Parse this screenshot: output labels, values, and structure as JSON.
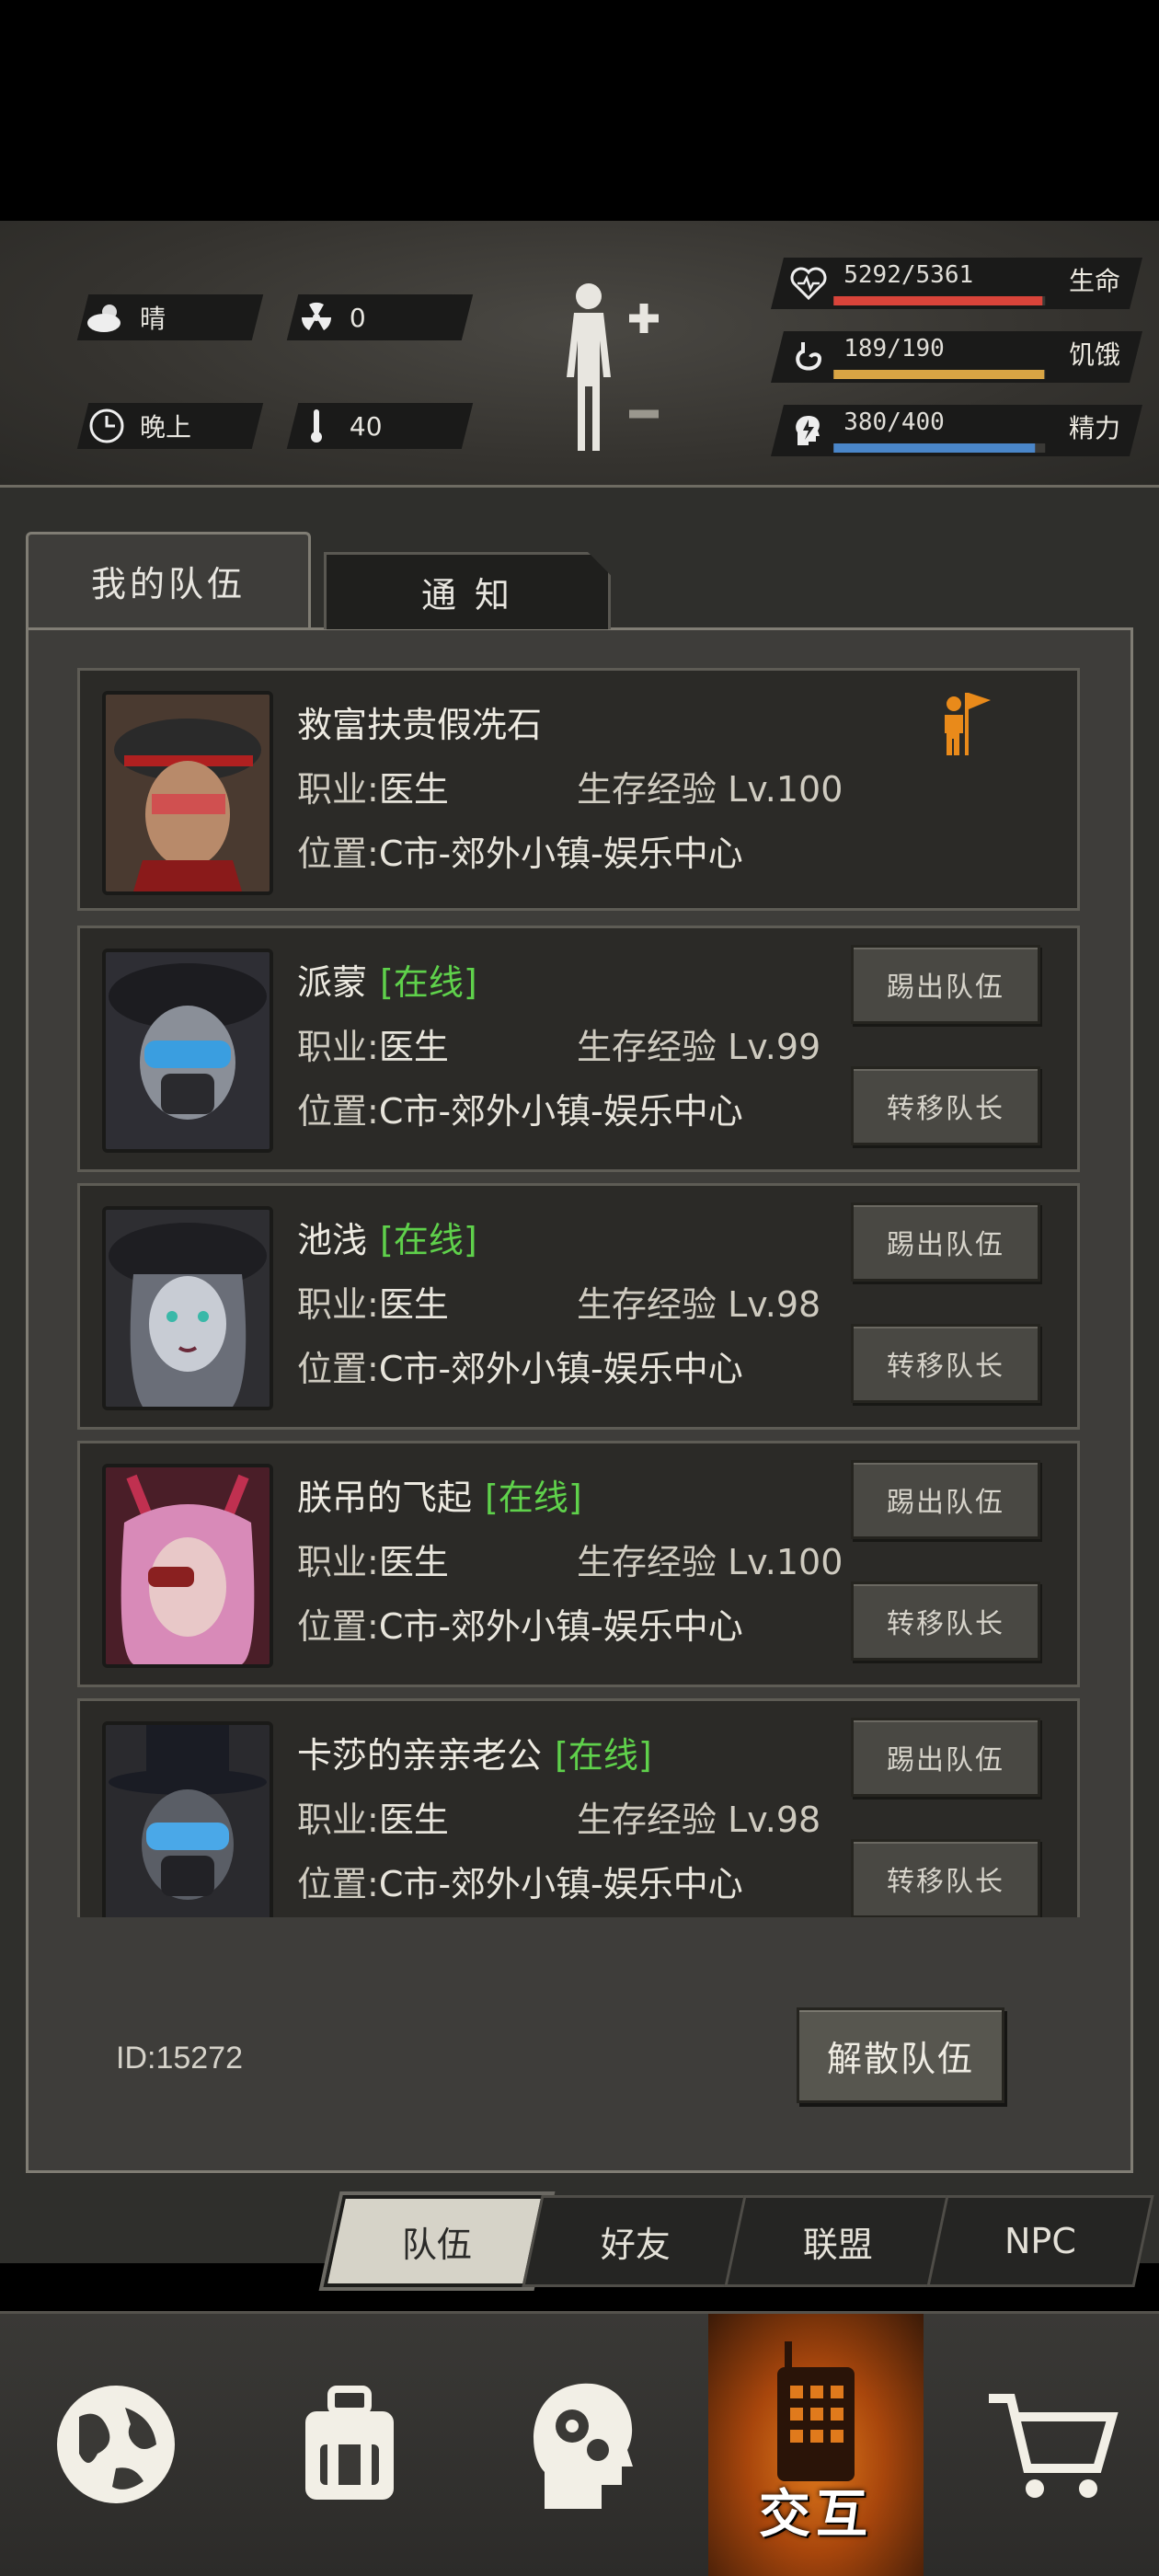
{
  "status": {
    "weather": "晴",
    "radiation": "0",
    "time_of_day": "晚上",
    "temperature": "40",
    "stats": [
      {
        "label": "生命",
        "value": "5292/5361",
        "fraction": 0.987,
        "color": "#d9443a"
      },
      {
        "label": "饥饿",
        "value": "189/190",
        "fraction": 0.995,
        "color": "#d9a544"
      },
      {
        "label": "精力",
        "value": "380/400",
        "fraction": 0.95,
        "color": "#4a86c9"
      }
    ]
  },
  "tabs": {
    "team": "我的队伍",
    "notice": "通 知"
  },
  "members": [
    {
      "name": "救富扶贵假冼石",
      "online": "",
      "job_label": "职业:",
      "job": "医生",
      "exp": "生存经验 Lv.100",
      "loc_label": "位置:",
      "loc": "C市-郊外小镇-娱乐中心",
      "leader": true
    },
    {
      "name": "派蒙",
      "online": "[在线]",
      "job_label": "职业:",
      "job": "医生",
      "exp": "生存经验 Lv.99",
      "loc_label": "位置:",
      "loc": "C市-郊外小镇-娱乐中心",
      "leader": false
    },
    {
      "name": "池浅",
      "online": "[在线]",
      "job_label": "职业:",
      "job": "医生",
      "exp": "生存经验 Lv.98",
      "loc_label": "位置:",
      "loc": "C市-郊外小镇-娱乐中心",
      "leader": false
    },
    {
      "name": "朕吊的飞起",
      "online": "[在线]",
      "job_label": "职业:",
      "job": "医生",
      "exp": "生存经验 Lv.100",
      "loc_label": "位置:",
      "loc": "C市-郊外小镇-娱乐中心",
      "leader": false
    },
    {
      "name": "卡莎的亲亲老公",
      "online": "[在线]",
      "job_label": "职业:",
      "job": "医生",
      "exp": "生存经验 Lv.98",
      "loc_label": "位置:",
      "loc": "C市-郊外小镇-娱乐中心",
      "leader": false
    }
  ],
  "buttons": {
    "kick": "踢出队伍",
    "transfer": "转移队长",
    "disband": "解散队伍"
  },
  "team_id": "ID:15272",
  "subtabs": [
    "队伍",
    "好友",
    "联盟",
    "NPC"
  ],
  "nav": {
    "interact": "交互",
    "icons": [
      "globe-icon",
      "backpack-icon",
      "head-gears-icon",
      "radio-icon",
      "cart-icon"
    ]
  }
}
